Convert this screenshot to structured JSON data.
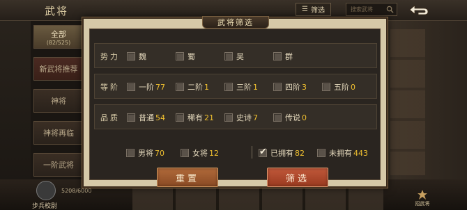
{
  "header": {
    "title": "武将",
    "filter_button_label": "筛选",
    "search_placeholder": "搜索武将"
  },
  "sidebar": {
    "tabs": [
      {
        "label": "全部",
        "sub": "(82/525)"
      },
      {
        "label": "新武将推荐",
        "sub": ""
      },
      {
        "label": "神将",
        "sub": ""
      },
      {
        "label": "神将再临",
        "sub": ""
      },
      {
        "label": "一阶武将",
        "sub": ""
      }
    ]
  },
  "footer": {
    "progress_text": "5208/6000",
    "player_name": "步兵校尉",
    "right_button_label": "招武将"
  },
  "dialog": {
    "title": "武将筛选",
    "faction": {
      "label": "势力",
      "options": [
        {
          "label": "魏",
          "checked": false
        },
        {
          "label": "蜀",
          "checked": false
        },
        {
          "label": "吴",
          "checked": false
        },
        {
          "label": "群",
          "checked": false
        }
      ]
    },
    "tier": {
      "label": "等阶",
      "options": [
        {
          "label": "一阶",
          "count": "77",
          "checked": false
        },
        {
          "label": "二阶",
          "count": "1",
          "checked": false
        },
        {
          "label": "三阶",
          "count": "1",
          "checked": false
        },
        {
          "label": "四阶",
          "count": "3",
          "checked": false
        },
        {
          "label": "五阶",
          "count": "0",
          "checked": false
        }
      ]
    },
    "quality": {
      "label": "品质",
      "options": [
        {
          "label": "普通",
          "count": "54",
          "checked": false
        },
        {
          "label": "稀有",
          "count": "21",
          "checked": false
        },
        {
          "label": "史诗",
          "count": "7",
          "checked": false
        },
        {
          "label": "传说",
          "count": "0",
          "checked": false
        }
      ]
    },
    "gender": [
      {
        "label": "男将",
        "count": "70",
        "checked": false
      },
      {
        "label": "女将",
        "count": "12",
        "checked": false
      }
    ],
    "ownership": [
      {
        "label": "已拥有",
        "count": "82",
        "checked": true
      },
      {
        "label": "未拥有",
        "count": "443",
        "checked": false
      }
    ],
    "reset_label": "重置",
    "filter_label": "筛选"
  },
  "colors": {
    "count_accent": "#f0c030",
    "reset_button": "#a05a30",
    "filter_button": "#b04a2e"
  }
}
